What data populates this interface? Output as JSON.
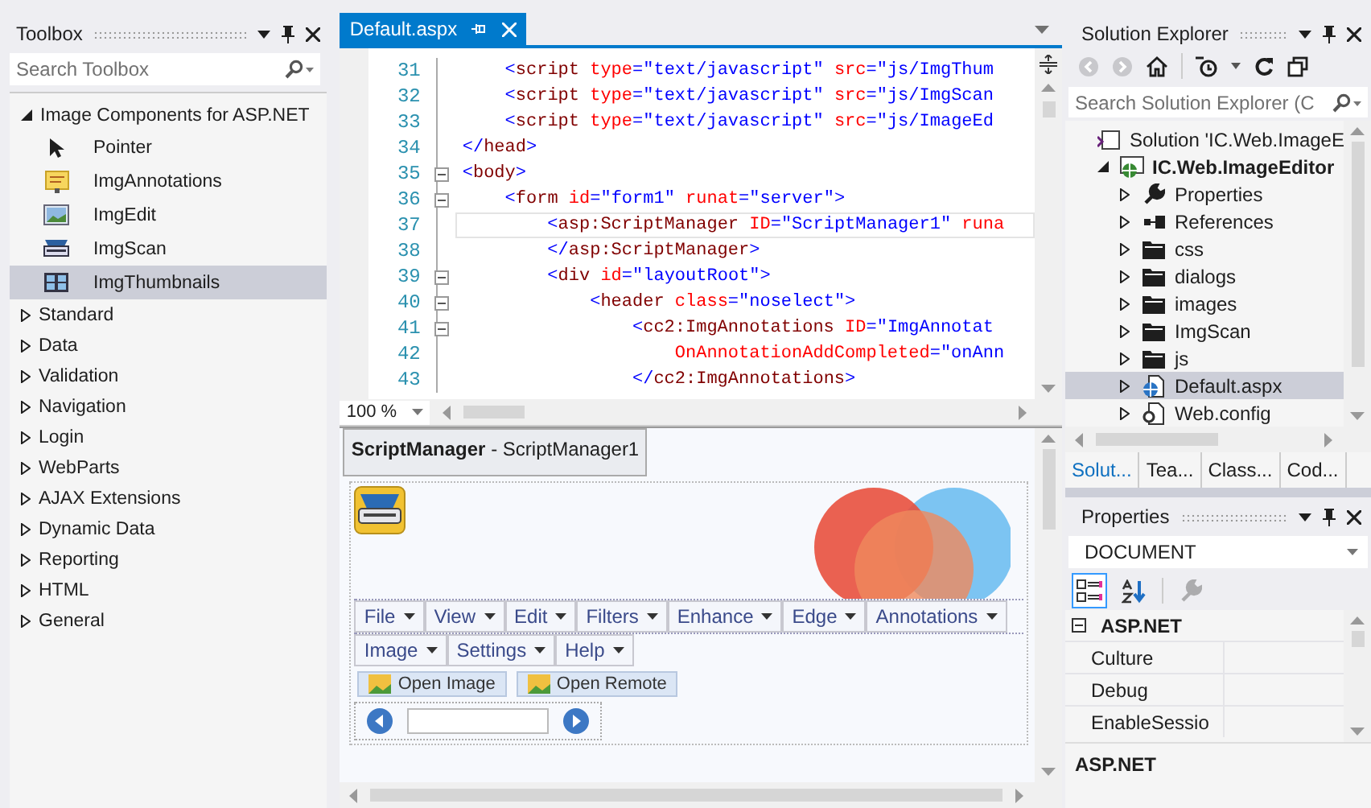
{
  "toolbox": {
    "title": "Toolbox",
    "search": {
      "placeholder": "Search Toolbox"
    },
    "groups": [
      {
        "label": "Image Components for ASP.NET",
        "expanded": true,
        "items": [
          {
            "label": "Pointer",
            "kind": "pointer",
            "selected": false
          },
          {
            "label": "ImgAnnotations",
            "kind": "note",
            "selected": false
          },
          {
            "label": "ImgEdit",
            "kind": "picture",
            "selected": false
          },
          {
            "label": "ImgScan",
            "kind": "scanner",
            "selected": false
          },
          {
            "label": "ImgThumbnails",
            "kind": "thumbnails",
            "selected": true
          }
        ]
      },
      {
        "label": "Standard",
        "expanded": false
      },
      {
        "label": "Data",
        "expanded": false
      },
      {
        "label": "Validation",
        "expanded": false
      },
      {
        "label": "Navigation",
        "expanded": false
      },
      {
        "label": "Login",
        "expanded": false
      },
      {
        "label": "WebParts",
        "expanded": false
      },
      {
        "label": "AJAX Extensions",
        "expanded": false
      },
      {
        "label": "Dynamic Data",
        "expanded": false
      },
      {
        "label": "Reporting",
        "expanded": false
      },
      {
        "label": "HTML",
        "expanded": false
      },
      {
        "label": "General",
        "expanded": false
      }
    ]
  },
  "editor": {
    "tab": {
      "label": "Default.aspx",
      "selected": true
    },
    "lines": [
      {
        "number": "31",
        "fold": false,
        "current": false,
        "tokens": [
          {
            "kind": "punct",
            "text": "    <"
          },
          {
            "kind": "tag",
            "text": "script"
          },
          {
            "kind": "attr",
            "text": " type"
          },
          {
            "kind": "punct",
            "text": "="
          },
          {
            "kind": "value",
            "text": "\"text/javascript\""
          },
          {
            "kind": "attr",
            "text": " src"
          },
          {
            "kind": "punct",
            "text": "="
          },
          {
            "kind": "value",
            "text": "\"js/ImgThum"
          }
        ]
      },
      {
        "number": "32",
        "fold": false,
        "current": false,
        "tokens": [
          {
            "kind": "punct",
            "text": "    <"
          },
          {
            "kind": "tag",
            "text": "script"
          },
          {
            "kind": "attr",
            "text": " type"
          },
          {
            "kind": "punct",
            "text": "="
          },
          {
            "kind": "value",
            "text": "\"text/javascript\""
          },
          {
            "kind": "attr",
            "text": " src"
          },
          {
            "kind": "punct",
            "text": "="
          },
          {
            "kind": "value",
            "text": "\"js/ImgScan"
          }
        ]
      },
      {
        "number": "33",
        "fold": false,
        "current": false,
        "tokens": [
          {
            "kind": "punct",
            "text": "    <"
          },
          {
            "kind": "tag",
            "text": "script"
          },
          {
            "kind": "attr",
            "text": " type"
          },
          {
            "kind": "punct",
            "text": "="
          },
          {
            "kind": "value",
            "text": "\"text/javascript\""
          },
          {
            "kind": "attr",
            "text": " src"
          },
          {
            "kind": "punct",
            "text": "="
          },
          {
            "kind": "value",
            "text": "\"js/ImageEd"
          }
        ]
      },
      {
        "number": "34",
        "fold": false,
        "current": false,
        "tokens": [
          {
            "kind": "punct",
            "text": "</"
          },
          {
            "kind": "tag",
            "text": "head"
          },
          {
            "kind": "punct",
            "text": ">"
          }
        ]
      },
      {
        "number": "35",
        "fold": true,
        "current": false,
        "tokens": [
          {
            "kind": "punct",
            "text": "<"
          },
          {
            "kind": "tag",
            "text": "body"
          },
          {
            "kind": "punct",
            "text": ">"
          }
        ]
      },
      {
        "number": "36",
        "fold": true,
        "current": false,
        "tokens": [
          {
            "kind": "punct",
            "text": "    <"
          },
          {
            "kind": "tag",
            "text": "form"
          },
          {
            "kind": "attr",
            "text": " id"
          },
          {
            "kind": "punct",
            "text": "="
          },
          {
            "kind": "value",
            "text": "\"form1\""
          },
          {
            "kind": "attr",
            "text": " runat"
          },
          {
            "kind": "punct",
            "text": "="
          },
          {
            "kind": "value",
            "text": "\"server\""
          },
          {
            "kind": "punct",
            "text": ">"
          }
        ]
      },
      {
        "number": "37",
        "fold": false,
        "current": true,
        "tokens": [
          {
            "kind": "punct",
            "text": "        <"
          },
          {
            "kind": "tag",
            "text": "asp:ScriptManager"
          },
          {
            "kind": "attr",
            "text": " ID"
          },
          {
            "kind": "punct",
            "text": "="
          },
          {
            "kind": "value",
            "text": "\"ScriptManager1\""
          },
          {
            "kind": "attr",
            "text": " runa"
          }
        ]
      },
      {
        "number": "38",
        "fold": false,
        "current": false,
        "tokens": [
          {
            "kind": "punct",
            "text": "        </"
          },
          {
            "kind": "tag",
            "text": "asp:ScriptManager"
          },
          {
            "kind": "punct",
            "text": ">"
          }
        ]
      },
      {
        "number": "39",
        "fold": true,
        "current": false,
        "tokens": [
          {
            "kind": "punct",
            "text": "        <"
          },
          {
            "kind": "tag",
            "text": "div"
          },
          {
            "kind": "attr",
            "text": " id"
          },
          {
            "kind": "punct",
            "text": "="
          },
          {
            "kind": "value",
            "text": "\"layoutRoot\""
          },
          {
            "kind": "punct",
            "text": ">"
          }
        ]
      },
      {
        "number": "40",
        "fold": true,
        "current": false,
        "tokens": [
          {
            "kind": "punct",
            "text": "            <"
          },
          {
            "kind": "tag",
            "text": "header"
          },
          {
            "kind": "attr",
            "text": " class"
          },
          {
            "kind": "punct",
            "text": "="
          },
          {
            "kind": "value",
            "text": "\"noselect\""
          },
          {
            "kind": "punct",
            "text": ">"
          }
        ]
      },
      {
        "number": "41",
        "fold": true,
        "current": false,
        "tokens": [
          {
            "kind": "punct",
            "text": "                <"
          },
          {
            "kind": "tag",
            "text": "cc2:ImgAnnotations"
          },
          {
            "kind": "attr",
            "text": " ID"
          },
          {
            "kind": "punct",
            "text": "="
          },
          {
            "kind": "value",
            "text": "\"ImgAnnotat"
          }
        ]
      },
      {
        "number": "42",
        "fold": false,
        "current": false,
        "tokens": [
          {
            "kind": "attr",
            "text": "                    OnAnnotationAddCompleted"
          },
          {
            "kind": "punct",
            "text": "="
          },
          {
            "kind": "value",
            "text": "\"onAnn"
          }
        ]
      },
      {
        "number": "43",
        "fold": false,
        "current": false,
        "tokens": [
          {
            "kind": "punct",
            "text": "                </"
          },
          {
            "kind": "tag",
            "text": "cc2:ImgAnnotations"
          },
          {
            "kind": "punct",
            "text": ">"
          }
        ]
      }
    ],
    "zoom": "100 %"
  },
  "designer": {
    "selection_tag": "**ScriptManager** - ScriptManager1",
    "menu_row_1": [
      "File",
      "View",
      "Edit",
      "Filters",
      "Enhance",
      "Edge",
      "Annotations"
    ],
    "menu_row_2": [
      "Image",
      "Settings",
      "Help"
    ],
    "buttons": [
      "Open Image",
      "Open Remote"
    ]
  },
  "solution_explorer": {
    "title": "Solution Explorer",
    "search": {
      "placeholder": "Search Solution Explorer (C"
    },
    "tree": [
      {
        "label": "Solution 'IC.Web.ImageE",
        "kind": "solution",
        "selected": false,
        "children": [
          {
            "label": "IC.Web.ImageEditor",
            "kind": "project",
            "expanded": true,
            "selected": false,
            "children": [
              {
                "label": "Properties",
                "kind": "wrench",
                "expanded": false,
                "selected": false
              },
              {
                "label": "References",
                "kind": "references",
                "expanded": false,
                "selected": false
              },
              {
                "label": "css",
                "kind": "folder",
                "expanded": false,
                "selected": false
              },
              {
                "label": "dialogs",
                "kind": "folder",
                "expanded": false,
                "selected": false
              },
              {
                "label": "images",
                "kind": "folder",
                "expanded": false,
                "selected": false
              },
              {
                "label": "ImgScan",
                "kind": "folder",
                "expanded": false,
                "selected": false
              },
              {
                "label": "js",
                "kind": "folder",
                "expanded": false,
                "selected": false
              },
              {
                "label": "Default.aspx",
                "kind": "web-page",
                "expanded": false,
                "selected": true
              },
              {
                "label": "Web.config",
                "kind": "config",
                "expanded": false,
                "selected": false
              }
            ]
          }
        ]
      }
    ],
    "tabs": [
      {
        "label": "Solut...",
        "selected": true
      },
      {
        "label": "Tea...",
        "selected": false
      },
      {
        "label": "Class...",
        "selected": false
      },
      {
        "label": "Cod...",
        "selected": false
      }
    ]
  },
  "properties": {
    "title": "Properties",
    "object": "DOCUMENT",
    "toolbar": [
      {
        "kind": "categorized",
        "selected": true,
        "disabled": false
      },
      {
        "kind": "alphabetical",
        "selected": false,
        "disabled": false
      },
      {
        "kind": "property-pages",
        "selected": false,
        "disabled": true
      }
    ],
    "category": {
      "label": "ASP.NET",
      "expanded": true,
      "rows": [
        "Culture",
        "Debug",
        "EnableSessio"
      ]
    },
    "description": "ASP.NET"
  }
}
